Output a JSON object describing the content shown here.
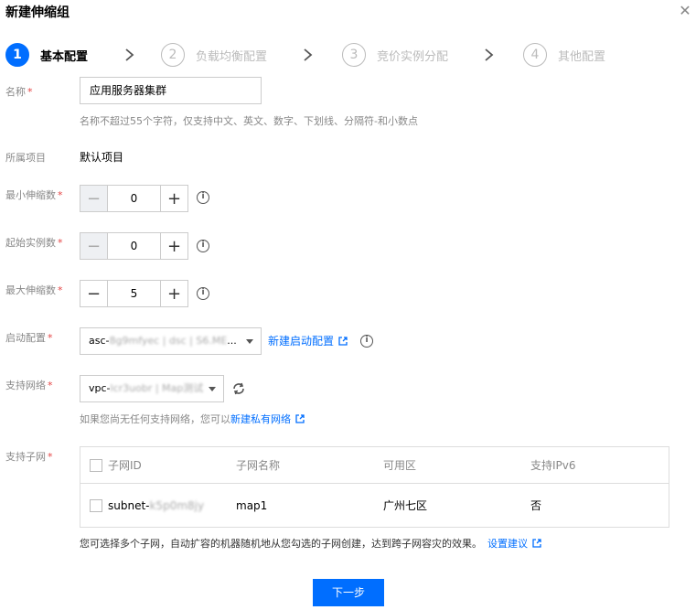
{
  "dialog": {
    "title": "新建伸缩组"
  },
  "steps": [
    {
      "num": "1",
      "label": "基本配置"
    },
    {
      "num": "2",
      "label": "负载均衡配置"
    },
    {
      "num": "3",
      "label": "竞价实例分配"
    },
    {
      "num": "4",
      "label": "其他配置"
    }
  ],
  "form": {
    "name": {
      "label": "名称",
      "value": "应用服务器集群",
      "hint": "名称不超过55个字符，仅支持中文、英文、数字、下划线、分隔符-和小数点"
    },
    "project": {
      "label": "所属项目",
      "value": "默认项目"
    },
    "min_size": {
      "label": "最小伸缩数",
      "value": "0",
      "minus_disabled": true
    },
    "desired": {
      "label": "起始实例数",
      "value": "0",
      "minus_disabled": true
    },
    "max_size": {
      "label": "最大伸缩数",
      "value": "5",
      "minus_disabled": false
    },
    "launch_config": {
      "label": "启动配置",
      "value_prefix": "asc-",
      "value_masked": "8g9mfyec | dsc | S6.ME",
      "value_suffix": "...",
      "create_link": "新建启动配置"
    },
    "network": {
      "label": "支持网络",
      "value_prefix": "vpc-",
      "value_masked": "lcr3uobr | Map测试",
      "hint_prefix": "如果您尚无任何支持网络，您可以",
      "create_link": "新建私有网络"
    },
    "subnet": {
      "label": "支持子网",
      "columns": [
        "子网ID",
        "子网名称",
        "可用区",
        "支持IPv6"
      ],
      "rows": [
        {
          "id_prefix": "subnet-",
          "id_masked": "k5p0m8jy",
          "name": "map1",
          "zone": "广州七区",
          "ipv6": "否"
        }
      ],
      "hint": "您可选择多个子网，自动扩容的机器随机地从您勾选的子网创建，达到跨子网容灾的效果。",
      "hint_link": "设置建议"
    }
  },
  "footer": {
    "next_label": "下一步"
  },
  "required_mark": "*",
  "colors": {
    "primary": "#006eff",
    "required": "#e54545",
    "muted": "#888888"
  },
  "icons": {
    "close": "close-icon",
    "info": "info-icon",
    "external": "external-link-icon",
    "refresh": "refresh-icon"
  }
}
